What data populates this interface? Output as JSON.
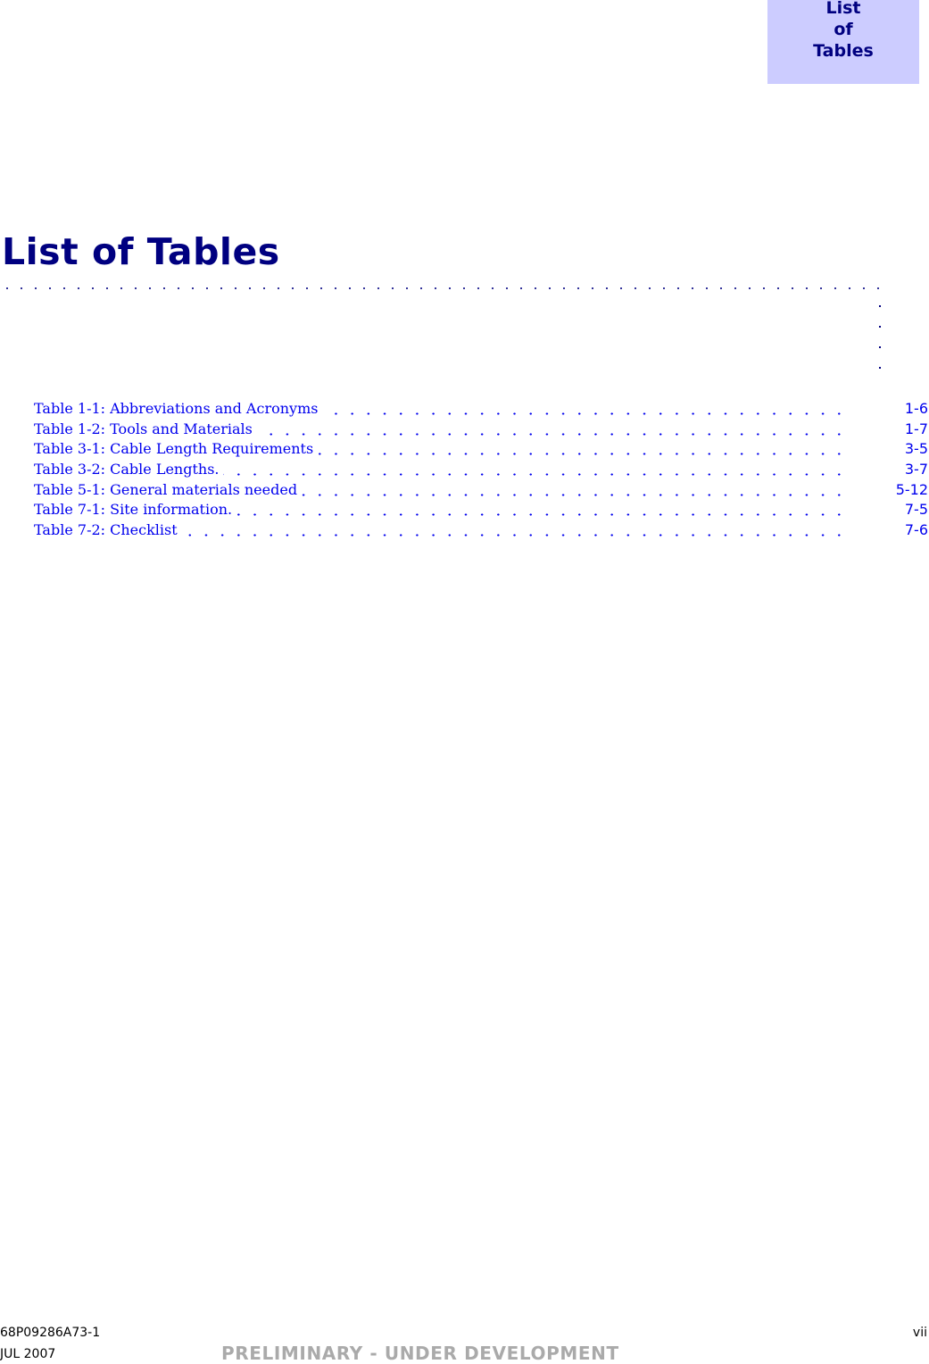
{
  "tab": {
    "lines": [
      "List",
      "of",
      "Tables"
    ]
  },
  "page_title": "List of Tables",
  "colors": {
    "heading": "#000080",
    "tab_background": "#ccccff",
    "link": "#0000ee",
    "status": "#aaaaaa"
  },
  "entries": [
    {
      "label": "Table 1-1: Abbreviations and Acronyms",
      "page": "1-6"
    },
    {
      "label": "Table 1-2: Tools and Materials",
      "page": "1-7"
    },
    {
      "label": "Table 3-1: Cable Length Requirements",
      "page": "3-5"
    },
    {
      "label": "Table 3-2: Cable Lengths.",
      "page": "3-7"
    },
    {
      "label": "Table 5-1: General materials needed",
      "page": "5-12"
    },
    {
      "label": "Table 7-1: Site information.",
      "page": "7-5"
    },
    {
      "label": "Table 7-2: Checklist",
      "page": "7-6"
    }
  ],
  "footer": {
    "doc_number": "68P09286A73-1",
    "page_number": "vii",
    "date": "JUL 2007",
    "status": "PRELIMINARY - UNDER DEVELOPMENT"
  }
}
